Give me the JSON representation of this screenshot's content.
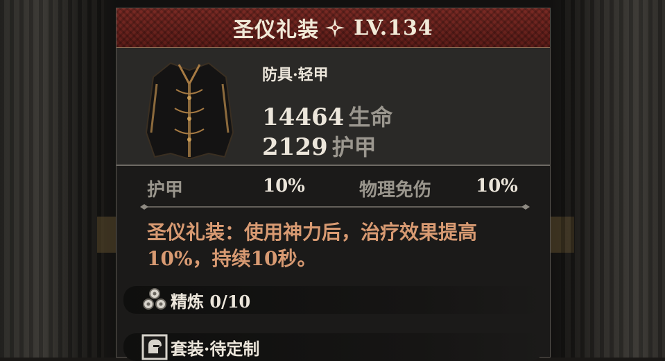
{
  "item": {
    "name": "圣仪礼装",
    "level": "LV.134",
    "category": "防具·轻甲",
    "stats": [
      {
        "value": "14464",
        "label": "生命"
      },
      {
        "value": "2129",
        "label": "护甲"
      }
    ],
    "substats": [
      {
        "label": "护甲",
        "value": "10%"
      },
      {
        "label": "物理免伤",
        "value": "10%"
      }
    ],
    "effect_line1": "圣仪礼装：使用神力后，治疗效果提高",
    "effect_line2": "10%，持续10秒。"
  },
  "slots": {
    "refine_label": "精炼 0/10",
    "set_label": "套装·待定制"
  },
  "colors": {
    "title_bar": "#6e2420",
    "effect_text": "#d89a72",
    "panel_bg": "#1b1a19"
  },
  "icons": {
    "rarity": "four-point-star-icon",
    "refine": "gem-cluster-icon",
    "set": "helmet-icon"
  }
}
